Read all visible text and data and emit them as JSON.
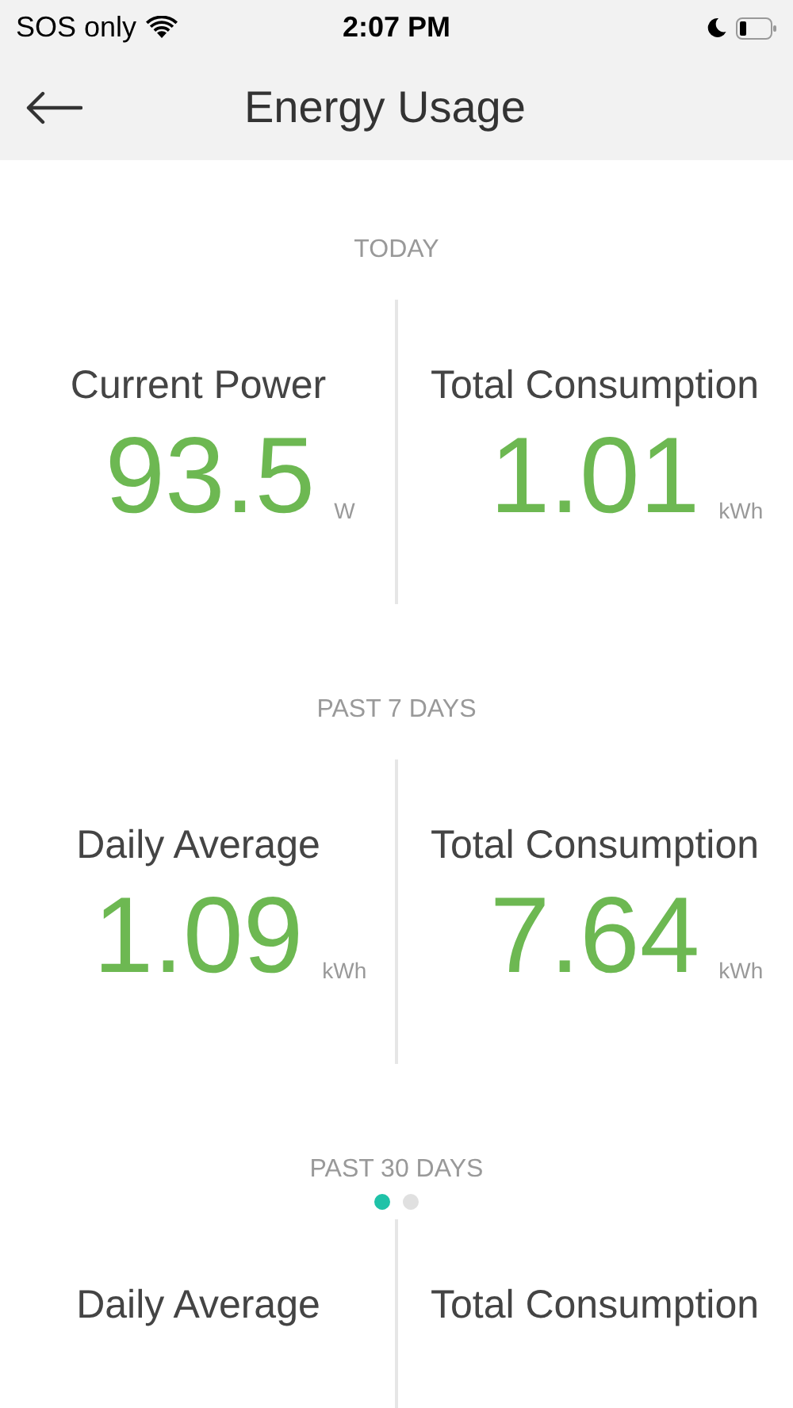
{
  "status_bar": {
    "carrier": "SOS only",
    "time": "2:07 PM"
  },
  "header": {
    "title": "Energy Usage"
  },
  "sections": [
    {
      "label": "TODAY",
      "stats": [
        {
          "label": "Current Power",
          "value": "93.5",
          "unit": "W"
        },
        {
          "label": "Total Consumption",
          "value": "1.01",
          "unit": "kWh"
        }
      ]
    },
    {
      "label": "PAST 7 DAYS",
      "stats": [
        {
          "label": "Daily Average",
          "value": "1.09",
          "unit": "kWh"
        },
        {
          "label": "Total Consumption",
          "value": "7.64",
          "unit": "kWh"
        }
      ]
    },
    {
      "label": "PAST 30 DAYS",
      "stats": [
        {
          "label": "Daily Average"
        },
        {
          "label": "Total Consumption"
        }
      ]
    }
  ],
  "page_dots": [
    {
      "selected": true
    },
    {
      "selected": false
    }
  ]
}
